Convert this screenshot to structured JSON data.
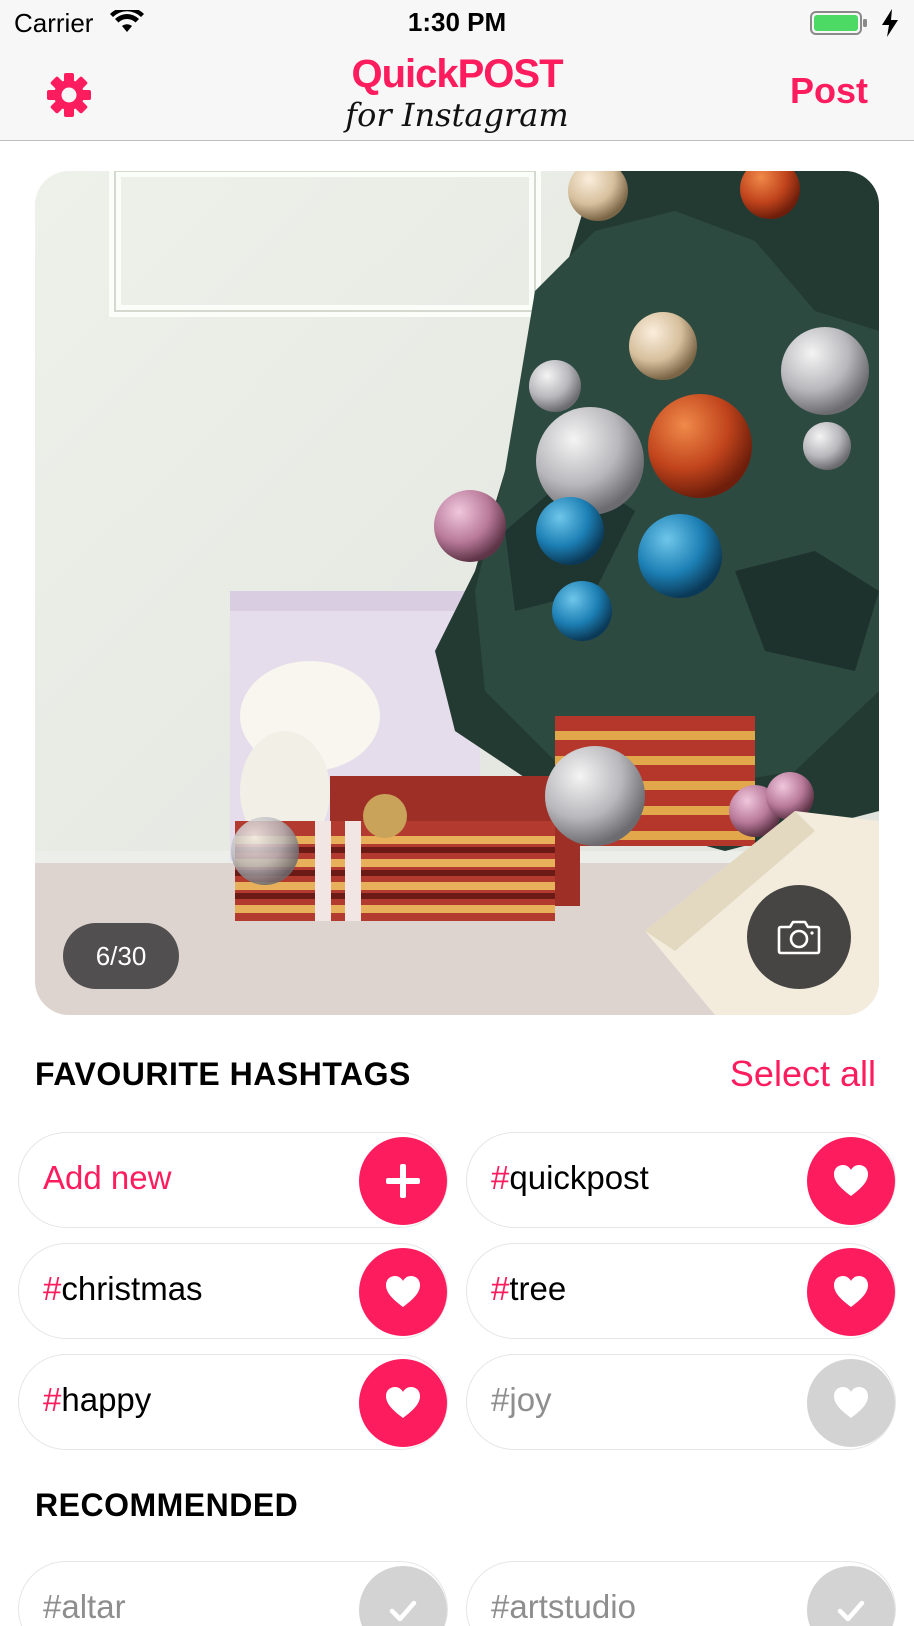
{
  "status_bar": {
    "carrier": "Carrier",
    "time": "1:30 PM",
    "battery_color": "#4cd964"
  },
  "nav": {
    "logo_top": "QuickPOST",
    "logo_bottom": "for Instagram",
    "post_label": "Post",
    "settings_icon": "gear-icon"
  },
  "photo": {
    "counter": "6/30",
    "camera_icon": "camera-icon"
  },
  "favourites": {
    "title": "FAVOURITE HASHTAGS",
    "select_all": "Select all",
    "add_new": "Add new",
    "tags": [
      {
        "hash": "#",
        "tag": "quickpost",
        "selected": true
      },
      {
        "hash": "#",
        "tag": "christmas",
        "selected": true
      },
      {
        "hash": "#",
        "tag": "tree",
        "selected": true
      },
      {
        "hash": "#",
        "tag": "happy",
        "selected": true
      },
      {
        "hash": "#",
        "tag": "joy",
        "selected": false
      }
    ]
  },
  "recommended": {
    "title": "RECOMMENDED",
    "tags": [
      {
        "hash": "#",
        "tag": "altar"
      },
      {
        "hash": "#",
        "tag": "artstudio"
      }
    ]
  },
  "colors": {
    "accent": "#fd1c5e",
    "inactive": "#d3d3d3"
  }
}
